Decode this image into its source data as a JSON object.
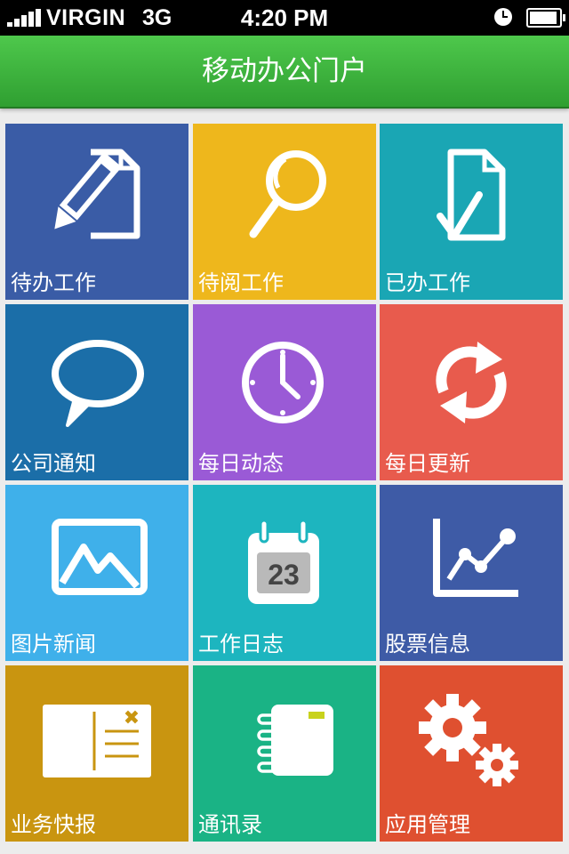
{
  "status_bar": {
    "carrier": "VIRGIN",
    "network": "3G",
    "time": "4:20 PM"
  },
  "header": {
    "title": "移动办公门户"
  },
  "tiles": [
    {
      "label": "待办工作",
      "icon": "edit-document-icon",
      "color": "#3a5ca6"
    },
    {
      "label": "待阅工作",
      "icon": "magnifier-icon",
      "color": "#eeb71c"
    },
    {
      "label": "已办工作",
      "icon": "document-check-icon",
      "color": "#1aa6b4"
    },
    {
      "label": "公司通知",
      "icon": "speech-bubble-icon",
      "color": "#1b6ea8"
    },
    {
      "label": "每日动态",
      "icon": "clock-icon",
      "color": "#9a5ad6"
    },
    {
      "label": "每日更新",
      "icon": "refresh-icon",
      "color": "#e85b4d"
    },
    {
      "label": "图片新闻",
      "icon": "picture-icon",
      "color": "#3fb0ea"
    },
    {
      "label": "工作日志",
      "icon": "calendar-icon",
      "color": "#1db5bf",
      "calendar_day": "23"
    },
    {
      "label": "股票信息",
      "icon": "line-chart-icon",
      "color": "#3e5ba6"
    },
    {
      "label": "业务快报",
      "icon": "postcard-icon",
      "color": "#c99510"
    },
    {
      "label": "通讯录",
      "icon": "address-book-icon",
      "color": "#1ab385"
    },
    {
      "label": "应用管理",
      "icon": "gears-icon",
      "color": "#df5030"
    }
  ]
}
